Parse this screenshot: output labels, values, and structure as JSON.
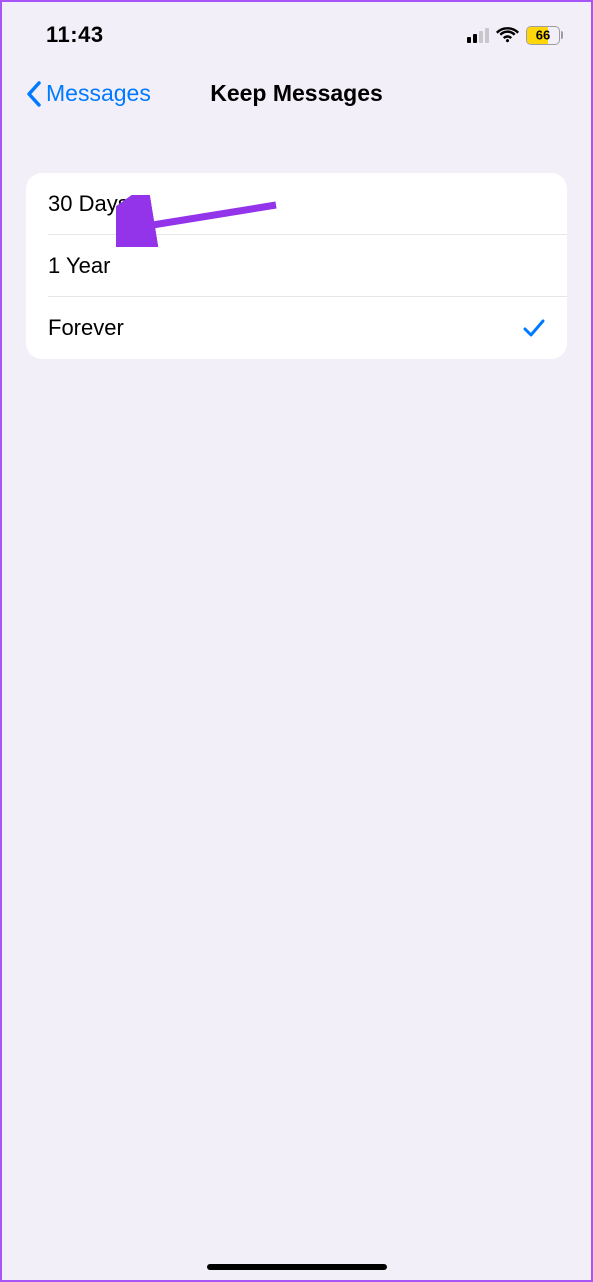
{
  "status": {
    "time": "11:43",
    "battery": "66"
  },
  "nav": {
    "back_label": "Messages",
    "title": "Keep Messages"
  },
  "options": [
    {
      "label": "30 Days",
      "selected": false
    },
    {
      "label": "1 Year",
      "selected": false
    },
    {
      "label": "Forever",
      "selected": true
    }
  ]
}
